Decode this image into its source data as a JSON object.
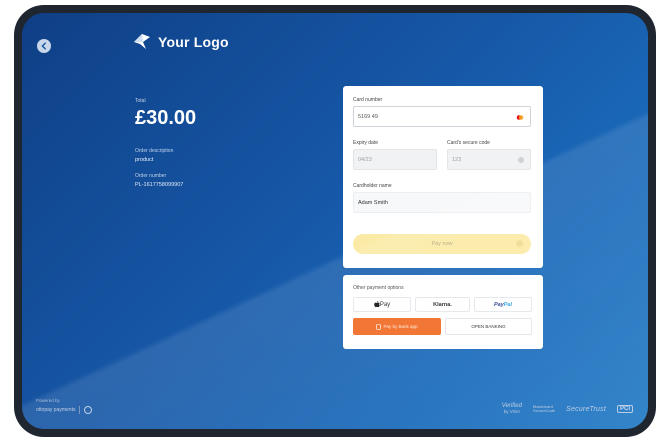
{
  "header": {
    "logo_text": "Your Logo"
  },
  "order": {
    "total_label": "Total",
    "amount": "£30.00",
    "description_label": "Order description",
    "description_value": "product",
    "number_label": "Order number",
    "number_value": "PL-1617758099907"
  },
  "card_form": {
    "card_number_label": "Card number",
    "card_number_value": "5169 49",
    "expiry_label": "Expiry date",
    "expiry_placeholder": "04/23",
    "security_label": "Card's secure code",
    "security_placeholder": "123",
    "cardholder_label": "Cardholder name",
    "cardholder_value": "Adam Smith",
    "pay_label": "Pay now"
  },
  "other_options": {
    "title": "Other payment options",
    "apple_pay": "Pay",
    "klarna": "Klarna.",
    "paypal_a": "Pay",
    "paypal_b": "Pal",
    "paybybank": "Pay by Bank app",
    "open_banking": "OPEN BANKING"
  },
  "footer": {
    "powered_by": "Powered by",
    "brand": "ottopay payments",
    "badge_visa_top": "Verified",
    "badge_visa_bottom": "by VISA",
    "badge_mc_1": "Mastercard",
    "badge_mc_2": "SecureCode",
    "badge_secure": "SecureTrust",
    "badge_pci": "PCI"
  },
  "colors": {
    "background_gradient_start": "#0f3f86",
    "background_gradient_end": "#2b80c8",
    "pay_button": "#fbeaa6",
    "paybybank": "#f16a23"
  }
}
